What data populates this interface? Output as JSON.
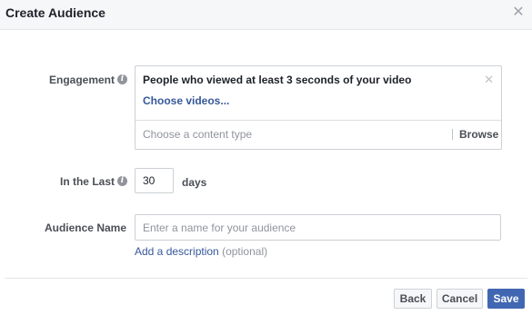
{
  "dialog": {
    "title": "Create Audience",
    "close_icon": "close-icon"
  },
  "engagement": {
    "label": "Engagement",
    "info_icon": "info-icon",
    "selected_title": "People who viewed at least 3 seconds of your video",
    "remove_icon": "close-icon",
    "choose_link": "Choose videos...",
    "content_type_placeholder": "Choose a content type",
    "browse_label": "Browse"
  },
  "in_the_last": {
    "label": "In the Last",
    "info_icon": "info-icon",
    "value": "30",
    "unit": "days"
  },
  "audience_name": {
    "label": "Audience Name",
    "placeholder": "Enter a name for your audience",
    "value": "",
    "add_description_link": "Add a description",
    "optional_note": "(optional)"
  },
  "footer": {
    "back_label": "Back",
    "cancel_label": "Cancel",
    "save_label": "Save"
  },
  "colors": {
    "link": "#365899",
    "primary_button": "#4267b2"
  }
}
